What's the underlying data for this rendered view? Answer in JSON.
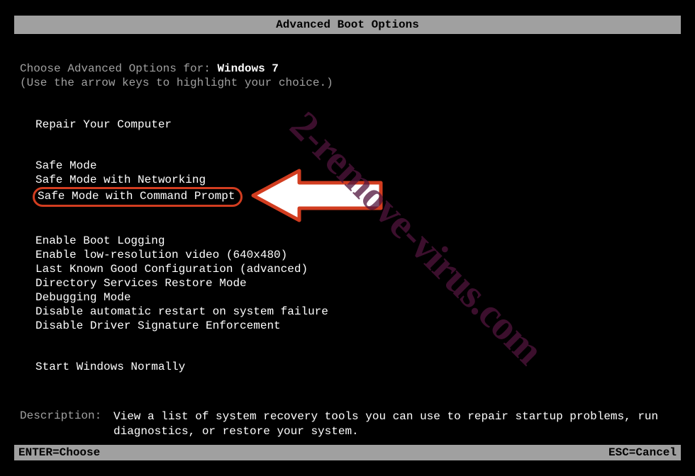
{
  "title": "Advanced Boot Options",
  "intro": {
    "prefix": "Choose Advanced Options for: ",
    "os": "Windows 7",
    "hint": "(Use the arrow keys to highlight your choice.)"
  },
  "menu": {
    "repair": "Repair Your Computer",
    "safe_mode": "Safe Mode",
    "safe_mode_net": "Safe Mode with Networking",
    "safe_mode_cmd": "Safe Mode with Command Prompt",
    "boot_log": "Enable Boot Logging",
    "low_res": "Enable low-resolution video (640x480)",
    "lkgc": "Last Known Good Configuration (advanced)",
    "ds_restore": "Directory Services Restore Mode",
    "debug": "Debugging Mode",
    "no_auto_restart": "Disable automatic restart on system failure",
    "no_sig_enforce": "Disable Driver Signature Enforcement",
    "start_normal": "Start Windows Normally"
  },
  "description": {
    "label": "Description:",
    "text": "View a list of system recovery tools you can use to repair startup problems, run diagnostics, or restore your system."
  },
  "footer": {
    "enter": "ENTER=Choose",
    "esc": "ESC=Cancel"
  },
  "watermark": "2-remove-virus.com"
}
